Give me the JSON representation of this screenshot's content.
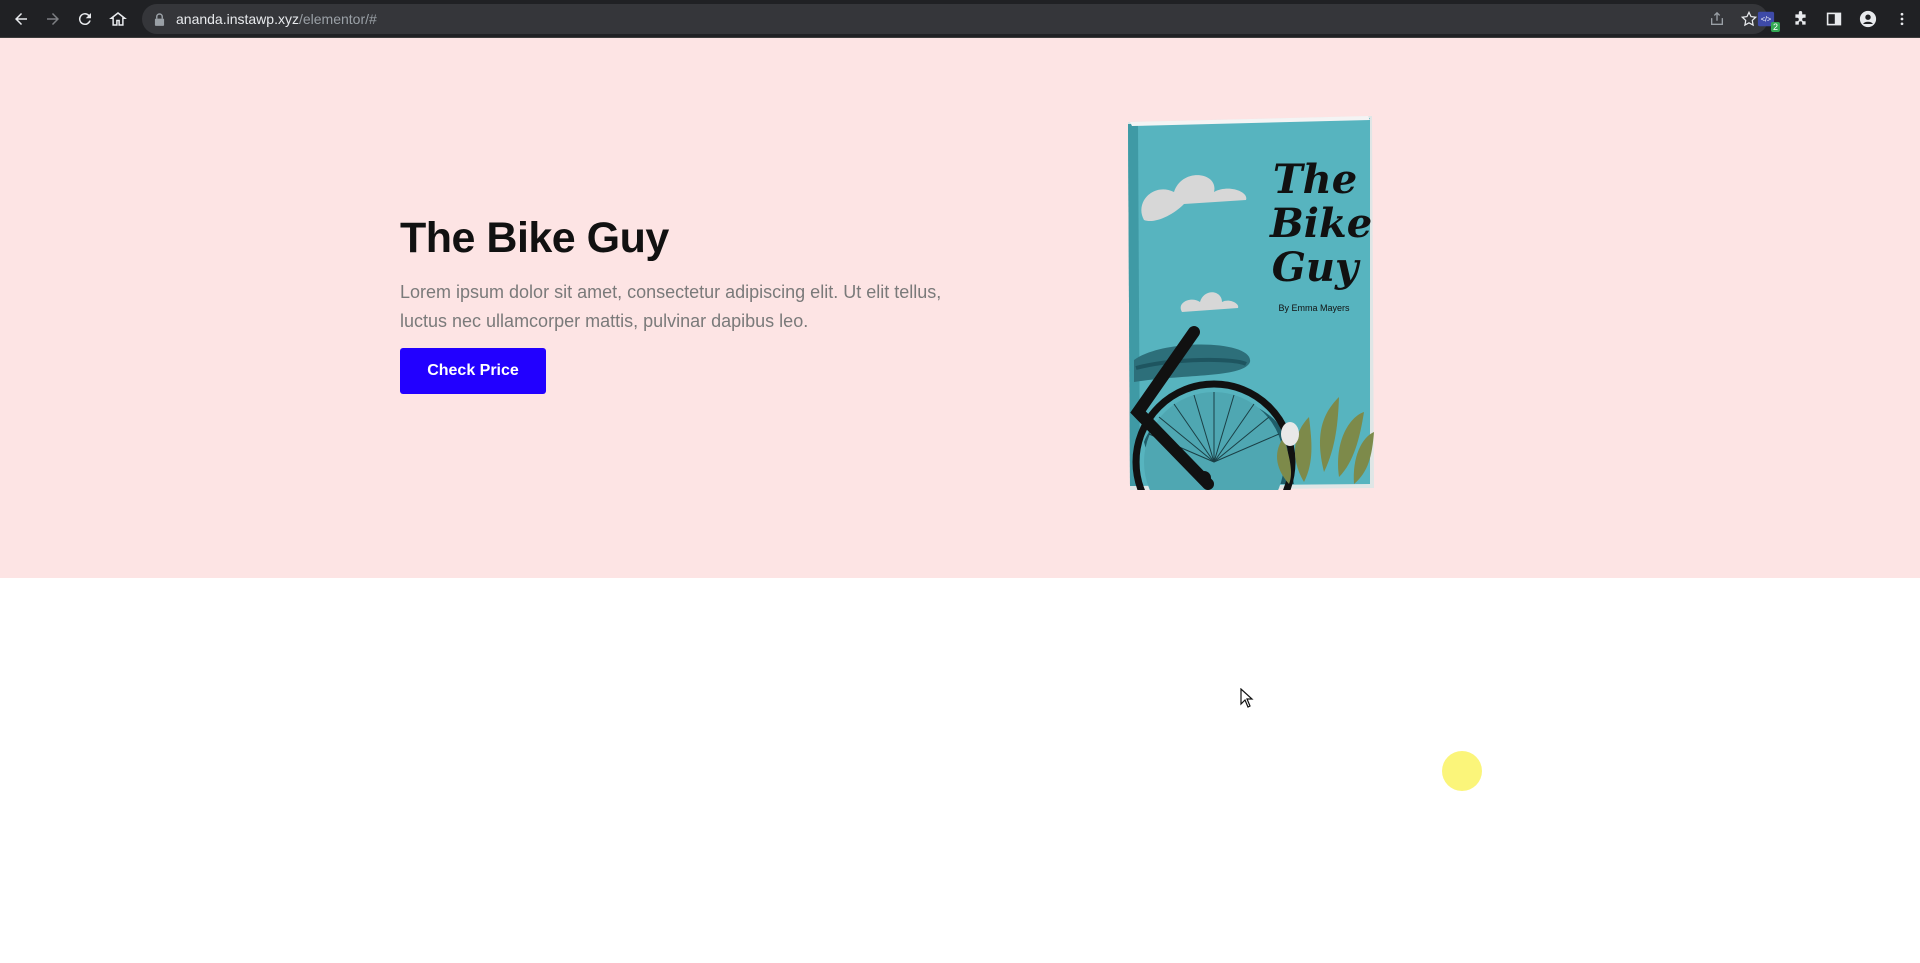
{
  "browser": {
    "url_host": "ananda.instawp.xyz",
    "url_path": "/elementor/#",
    "extension_badge": "2",
    "icons": [
      "back-icon",
      "forward-icon",
      "reload-icon",
      "home-icon",
      "lock-icon",
      "share-icon",
      "star-icon",
      "extension-icon",
      "puzzle-icon",
      "sidepanel-icon",
      "profile-icon",
      "menu-icon"
    ]
  },
  "hero": {
    "title": "The Bike Guy",
    "description": "Lorem ipsum dolor sit amet, consectetur adipiscing elit. Ut elit tellus, luctus nec ullamcorper mattis, pulvinar dapibus leo.",
    "cta_label": "Check Price",
    "background_color": "#fde4e4",
    "cta_color": "#2200ff"
  },
  "book_cover": {
    "title_lines": [
      "The",
      "Bike",
      "Guy"
    ],
    "author": "By Emma Mayers",
    "cover_color": "#57b4bf"
  }
}
